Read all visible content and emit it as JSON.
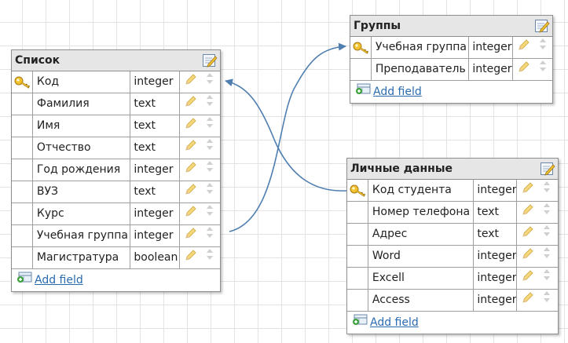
{
  "colors": {
    "link": "#4f7fb0",
    "header_bg": "#e6e6e6"
  },
  "add_field_label": "Add field",
  "tables": {
    "spisok": {
      "title": "Список",
      "fields": [
        {
          "name": "Код",
          "type": "integer",
          "key": true
        },
        {
          "name": "Фамилия",
          "type": "text"
        },
        {
          "name": "Имя",
          "type": "text"
        },
        {
          "name": "Отчество",
          "type": "text"
        },
        {
          "name": "Год рождения",
          "type": "integer"
        },
        {
          "name": "ВУЗ",
          "type": "text"
        },
        {
          "name": "Курс",
          "type": "integer"
        },
        {
          "name": "Учебная группа",
          "type": "integer"
        },
        {
          "name": "Магистратура",
          "type": "boolean"
        }
      ]
    },
    "gruppy": {
      "title": "Группы",
      "fields": [
        {
          "name": "Учебная группа",
          "type": "integer",
          "key": true
        },
        {
          "name": "Преподаватель",
          "type": "integer"
        }
      ]
    },
    "lichnye": {
      "title": "Личные данные",
      "fields": [
        {
          "name": "Код студента",
          "type": "integer",
          "key": true
        },
        {
          "name": "Номер телефона",
          "type": "text"
        },
        {
          "name": "Адрес",
          "type": "text"
        },
        {
          "name": "Word",
          "type": "integer"
        },
        {
          "name": "Excell",
          "type": "integer"
        },
        {
          "name": "Access",
          "type": "integer"
        }
      ]
    }
  }
}
